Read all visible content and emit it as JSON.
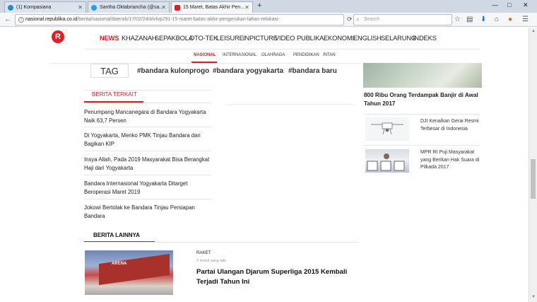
{
  "browser": {
    "tabs": [
      {
        "label": "(1) Kompasiana",
        "icon": "kompasiana-icon",
        "color": "#2a8ac7"
      },
      {
        "label": "Santha Oktabriancha (@sa...",
        "icon": "twitter-icon",
        "color": "#1da1f2"
      },
      {
        "label": "15 Maret, Batas Akhir Pen...",
        "icon": "republika-icon",
        "color": "#e51d20"
      }
    ],
    "new_tab": "+",
    "url_host": "nasional.republika.co.id",
    "url_path": "/berita/nasional/daerah/17/02/24/olvlvp291-15-maret-batas-akhir-pengerukan-lahan-relokasi-",
    "search_placeholder": "Search",
    "window_controls": [
      "—",
      "□",
      "✕"
    ]
  },
  "site": {
    "logo": "R",
    "brand_color": "#e51d20",
    "nav": [
      "NEWS",
      "KHAZANAH",
      "SEPAKBOLA",
      "OTO-TEK",
      "LEISURE",
      "INPICTURE",
      "VIDEO",
      "PUBLIKA",
      "EKONOMI",
      "ENGLISH",
      "SELARUNG",
      "INDEKS"
    ],
    "subnav": [
      "NASIONAL",
      "INTERNASIONAL",
      "OLAHRAGA",
      "PENDIDIKAN",
      "INTAN"
    ]
  },
  "tags": {
    "label": "TAG",
    "items": [
      "#bandara kulonprogo",
      "#bandara yogyakarta",
      "#bandara baru"
    ]
  },
  "related": {
    "title": "BERITA TERKAIT",
    "items": [
      "Penumpang Mancanegara di Bandara Yogyakarta Naik 63,7 Persen",
      "Di Yogyakarta, Menko PMK Tinjau Bandara dan Bagikan KIP",
      "Insya Allah, Pada 2019 Masyarakat Bisa Berangkat Haji dari Yogyakarta",
      "Bandara Internasional Yogyakarta Ditarget Beroperasi Maret 2019",
      "Jokowi Bertolak ke Bandara Tinjau Persiapan Bandara"
    ]
  },
  "other": {
    "title": "BERITA LAINNYA",
    "item": {
      "category": "RAKET",
      "time": "2 menit yang lalu",
      "headline": "Partai Ulangan Djarum Superliga 2015 Kembali Terjadi Tahun Ini"
    }
  },
  "sidebar": {
    "headline": "800 Ribu Orang Terdampak Banjir di Awal Tahun 2017",
    "items": [
      {
        "text": "DJI Kenalkan Gerai Resmi Terbesar di Indonesia"
      },
      {
        "text": "MPR RI Puji Masyarakat yang Berikan Hak Suara di Pilkada 2017"
      }
    ]
  }
}
